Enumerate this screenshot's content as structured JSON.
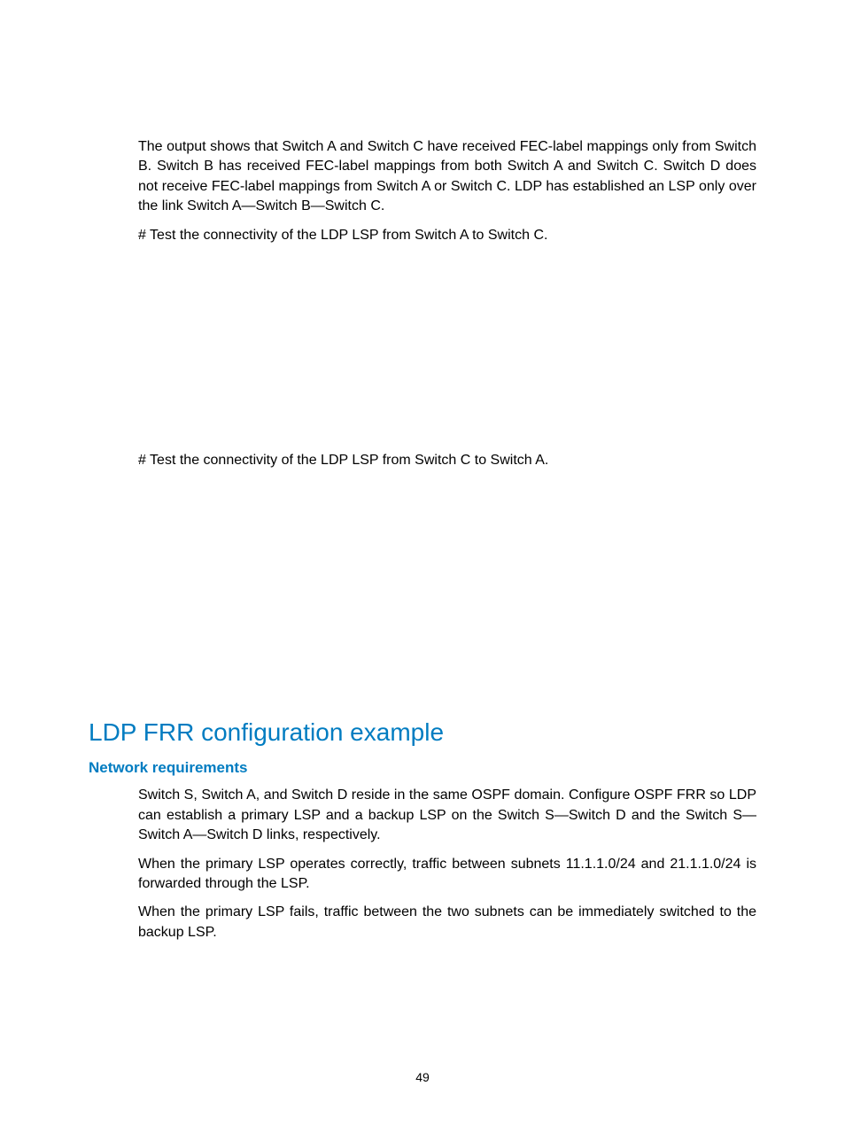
{
  "para1": "The output shows that Switch A and Switch C have received FEC-label mappings only from Switch B. Switch B has received FEC-label mappings from both Switch A and Switch C. Switch D does not receive FEC-label mappings from Switch A or Switch C. LDP has established an LSP only over the link Switch A—Switch B—Switch C.",
  "para2": "# Test the connectivity of the LDP LSP from Switch A to Switch C.",
  "para3": "# Test the connectivity of the LDP LSP from Switch C to Switch A.",
  "heading1": "LDP FRR configuration example",
  "heading2": "Network requirements",
  "para4": "Switch S, Switch A, and Switch D reside in the same OSPF domain. Configure OSPF FRR so LDP can establish a primary LSP and a backup LSP on the Switch S—Switch D and the Switch S—Switch A—Switch D links, respectively.",
  "para5": "When the primary LSP operates correctly, traffic between subnets 11.1.1.0/24 and 21.1.1.0/24 is forwarded through the LSP.",
  "para6": "When the primary LSP fails, traffic between the two subnets can be immediately switched to the backup LSP.",
  "pageNumber": "49"
}
